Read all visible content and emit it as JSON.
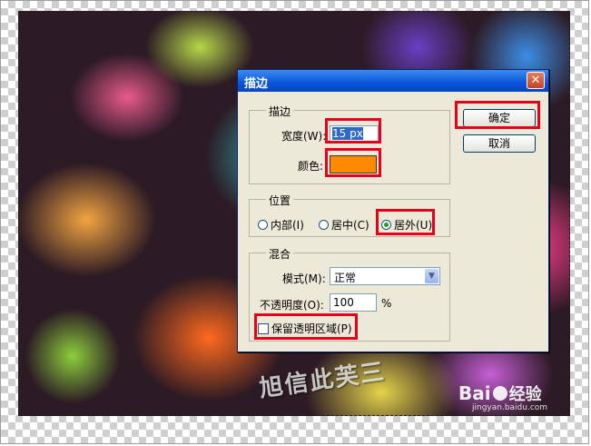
{
  "dialog": {
    "title": "描边",
    "close_glyph": "✕",
    "ok_label": "确定",
    "cancel_label": "取消"
  },
  "stroke_group": {
    "title": "描边",
    "width_label": "宽度(W):",
    "width_value": "15 px",
    "color_label": "颜色:",
    "color_swatch": "#ff8a00"
  },
  "location_group": {
    "title": "位置",
    "options": [
      {
        "label": "内部(I)",
        "selected": false
      },
      {
        "label": "居中(C)",
        "selected": false
      },
      {
        "label": "居外(U)",
        "selected": true
      }
    ]
  },
  "blending_group": {
    "title": "混合",
    "mode_label": "模式(M):",
    "mode_value": "正常",
    "opacity_label": "不透明度(O):",
    "opacity_value": "100",
    "opacity_unit": "%",
    "preserve_label": "保留透明区域(P)",
    "preserve_checked": false
  },
  "watermark": {
    "text": "旭信此芙三",
    "brand_left": "Bai",
    "brand_right": "经验",
    "url": "jingyan.baidu.com"
  },
  "colors": {
    "highlight": "#e8001a",
    "title_bar": "#0a55d8"
  }
}
